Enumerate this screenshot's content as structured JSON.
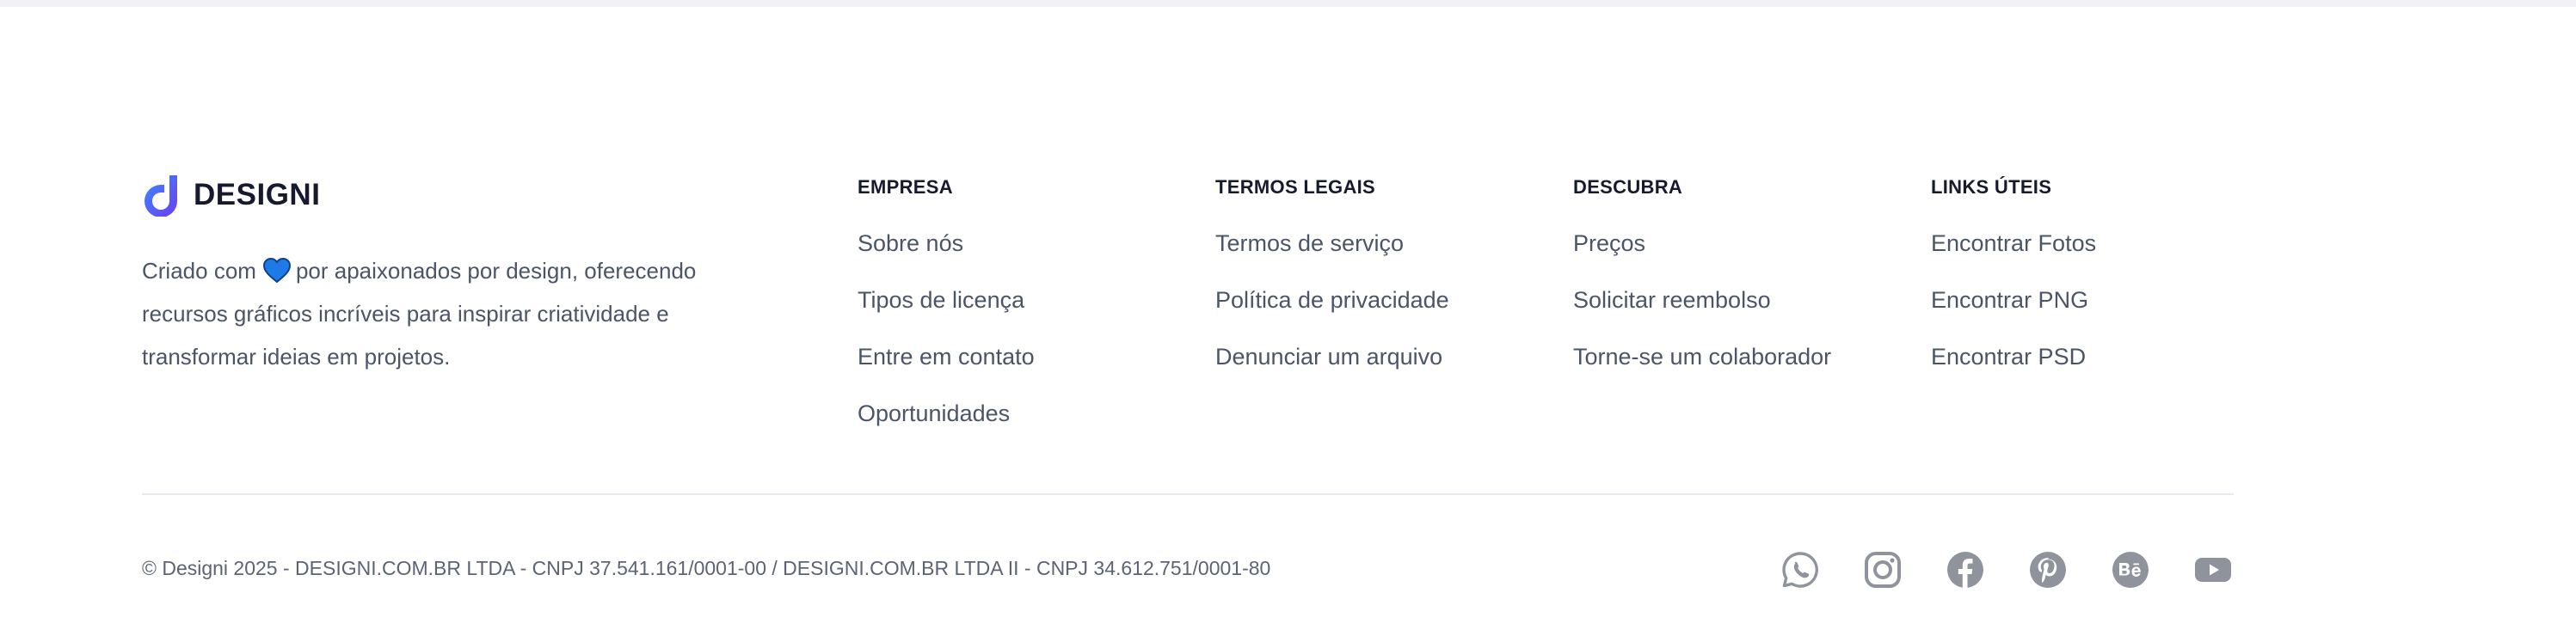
{
  "brand": {
    "name": "DESIGNI",
    "desc_before_heart": "Criado com",
    "desc_after_heart": "por apaixonados por design, oferecendo recursos gráficos incríveis para inspirar criatividade e transformar ideias em projetos.",
    "logo_icon": "designi-logo-icon",
    "heart_icon": "heart-icon",
    "accent_color": "#2f6bff"
  },
  "columns": [
    {
      "title": "EMPRESA",
      "links": [
        "Sobre nós",
        "Tipos de licença",
        "Entre em contato",
        "Oportunidades"
      ]
    },
    {
      "title": "TERMOS LEGAIS",
      "links": [
        "Termos de serviço",
        "Política de privacidade",
        "Denunciar um arquivo"
      ]
    },
    {
      "title": "DESCUBRA",
      "links": [
        "Preços",
        "Solicitar reembolso",
        "Torne-se um colaborador"
      ]
    },
    {
      "title": "LINKS ÚTEIS",
      "links": [
        "Encontrar Fotos",
        "Encontrar PNG",
        "Encontrar PSD"
      ]
    }
  ],
  "bottom": {
    "copyright": "© Designi 2025 - DESIGNI.COM.BR LTDA - CNPJ 37.541.161/0001-00 / DESIGNI.COM.BR LTDA II - CNPJ 34.612.751/0001-80"
  },
  "socials": [
    "whatsapp-icon",
    "instagram-icon",
    "facebook-icon",
    "pinterest-icon",
    "behance-icon",
    "youtube-icon"
  ],
  "colors": {
    "heading": "#161a2f",
    "text": "#4a5568",
    "icon": "#8e939c",
    "divider": "#e7e9ee"
  }
}
